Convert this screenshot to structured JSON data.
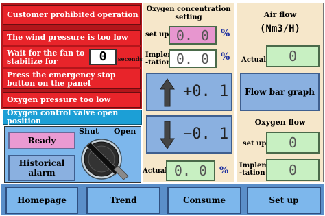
{
  "alarms": {
    "customer_prohibited": "Customer prohibited operation",
    "wind_pressure_low": "The wind pressure is too low",
    "wait_fan_line1": "Wait for the fan to",
    "wait_fan_line2": "stabilize for",
    "wait_seconds_value": "0",
    "wait_seconds_unit": "seconds",
    "emergency_line1": "Press the emergency stop",
    "emergency_line2": "button on the panel",
    "oxygen_pressure_low": "Oxygen pressure too low",
    "valve_open": "Oxygen control valve open position"
  },
  "controls": {
    "ready": "Ready",
    "historical_alarm": "Historical alarm",
    "shut_label": "Shut",
    "open_label": "Open"
  },
  "o2_concentration": {
    "title_line1": "Oxygen concentration",
    "title_line2": "setting",
    "setup_label": "set up",
    "setup_value": "0. 0",
    "impl_label_line1": "Implemen",
    "impl_label_line2": "-tation",
    "impl_value": "0. 0",
    "unit": "%",
    "increase_label": "+0. 1",
    "decrease_label": "−0. 1",
    "actual_label": "Actual",
    "actual_value": "0. 0",
    "actual_unit": "%"
  },
  "air_flow": {
    "title": "Air flow",
    "unit": "(Nm3/H)",
    "actual_label": "Actual",
    "actual_value": "0",
    "graph_button": "Flow bar graph"
  },
  "oxygen_flow": {
    "title": "Oxygen flow",
    "setup_label": "set up",
    "setup_value": "0",
    "impl_label_line1": "Implemen",
    "impl_label_line2": "-tation",
    "impl_value": "0"
  },
  "nav": {
    "homepage": "Homepage",
    "trend": "Trend",
    "consume": "Consume",
    "setup": "Set up"
  },
  "colors": {
    "alarm_red": "#e8242a",
    "status_cyan": "#1c9fd6",
    "panel_beige": "#f6e7ca",
    "button_blue": "#8ab0e0",
    "field_green": "#c8f0c2",
    "setup_pink": "#ea9ad2"
  }
}
